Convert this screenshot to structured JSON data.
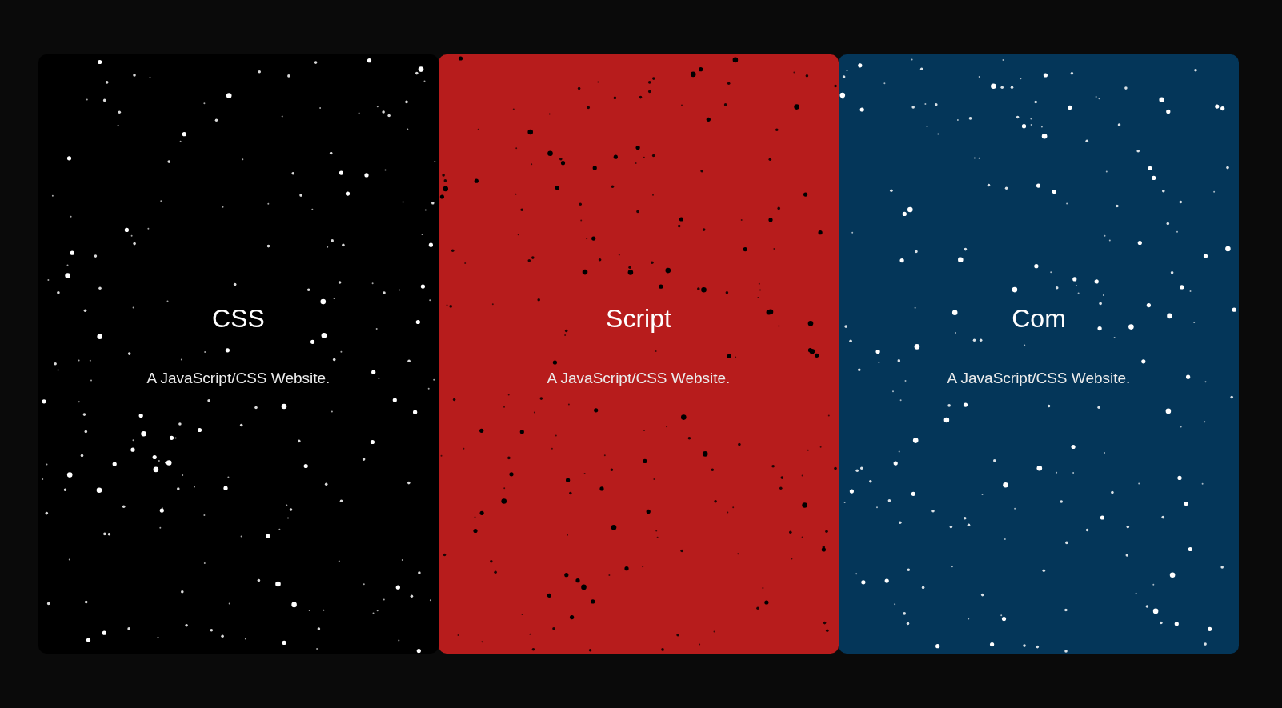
{
  "panels": [
    {
      "title": "CSS",
      "subtitle": "A JavaScript/CSS Website.",
      "color": "#000000"
    },
    {
      "title": "Script",
      "subtitle": "A JavaScript/CSS Website.",
      "color": "#b71c1c"
    },
    {
      "title": "Com",
      "subtitle": "A JavaScript/CSS Website.",
      "color": "#043659"
    }
  ]
}
